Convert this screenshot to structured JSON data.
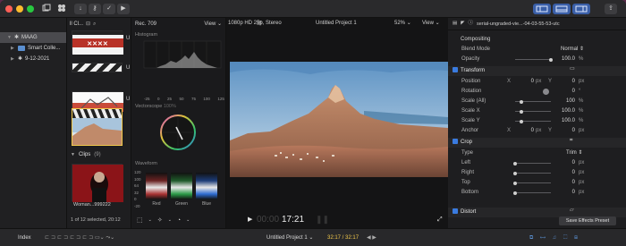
{
  "toolbar": {
    "icons": [
      "import-icon",
      "key-icon",
      "check-icon",
      "share-icon"
    ],
    "right_icons": [
      "library-layout-icon",
      "timeline-layout-icon",
      "inspector-layout-icon",
      "share-icon"
    ]
  },
  "library": {
    "items": [
      {
        "label": "MAAG",
        "expanded": true,
        "selected": true
      },
      {
        "label": "Smart Colle...",
        "expanded": false,
        "selected": false
      },
      {
        "label": "9-12-2021",
        "expanded": false,
        "selected": false
      }
    ]
  },
  "browser": {
    "title": "ll Cl...",
    "side_letters": [
      "U",
      "U",
      "U"
    ],
    "clips_label": "Clips",
    "clips_count": "(9)",
    "clip_name": "Woman...999222",
    "footer": "1 of 12 selected, 20:12"
  },
  "scopes": {
    "title": "Rec. 709",
    "view_label": "View",
    "histogram_label": "Histogram",
    "histogram_ticks": [
      "-25",
      "0",
      "25",
      "50",
      "75",
      "100",
      "125"
    ],
    "vectorscope_label": "Vectorscope",
    "vectorscope_sub": "100%",
    "waveform_label": "Waveform",
    "waveform_ticks": [
      "120",
      "100",
      "64",
      "32",
      "0",
      "-20"
    ],
    "channels": [
      "Red",
      "Green",
      "Blue"
    ]
  },
  "viewer": {
    "format": "1080p HD 25p, Stereo",
    "project": "Untitled Project 1",
    "zoom": "52%",
    "view_label": "View",
    "timecode_dim": "00:00",
    "timecode": "17:21"
  },
  "inspector": {
    "clip_title": "serial-ungraded-vie...-04-03-55-53-utc",
    "compositing": "Compositing",
    "blend_mode_label": "Blend Mode",
    "blend_mode_value": "Normal",
    "opacity_label": "Opacity",
    "opacity_value": "100.0",
    "opacity_unit": "%",
    "transform": "Transform",
    "position_label": "Position",
    "position_x_label": "X",
    "position_x": "0",
    "position_y_label": "Y",
    "position_y": "0",
    "px": "px",
    "rotation_label": "Rotation",
    "rotation_value": "0",
    "deg": "°",
    "scale_all_label": "Scale (All)",
    "scale_all": "100",
    "scale_x_label": "Scale X",
    "scale_x": "100.0",
    "scale_y_label": "Scale Y",
    "scale_y": "100.0",
    "anchor_label": "Anchor",
    "anchor_x_label": "X",
    "anchor_x": "0",
    "anchor_y_label": "Y",
    "anchor_y": "0",
    "crop": "Crop",
    "type_label": "Type",
    "type_value": "Trim",
    "left_label": "Left",
    "left_value": "0",
    "right_label": "Right",
    "right_value": "0",
    "top_label": "Top",
    "top_value": "0",
    "bottom_label": "Bottom",
    "bottom_value": "0",
    "distort": "Distort",
    "save_preset": "Save Effects Preset"
  },
  "bottombar": {
    "index": "Index",
    "project": "Untitled Project 1",
    "time": "32:17 / 32:17"
  },
  "colors": {
    "accent": "#3a7be0",
    "selection": "#f2c94c",
    "time_color": "#f2c94c"
  }
}
